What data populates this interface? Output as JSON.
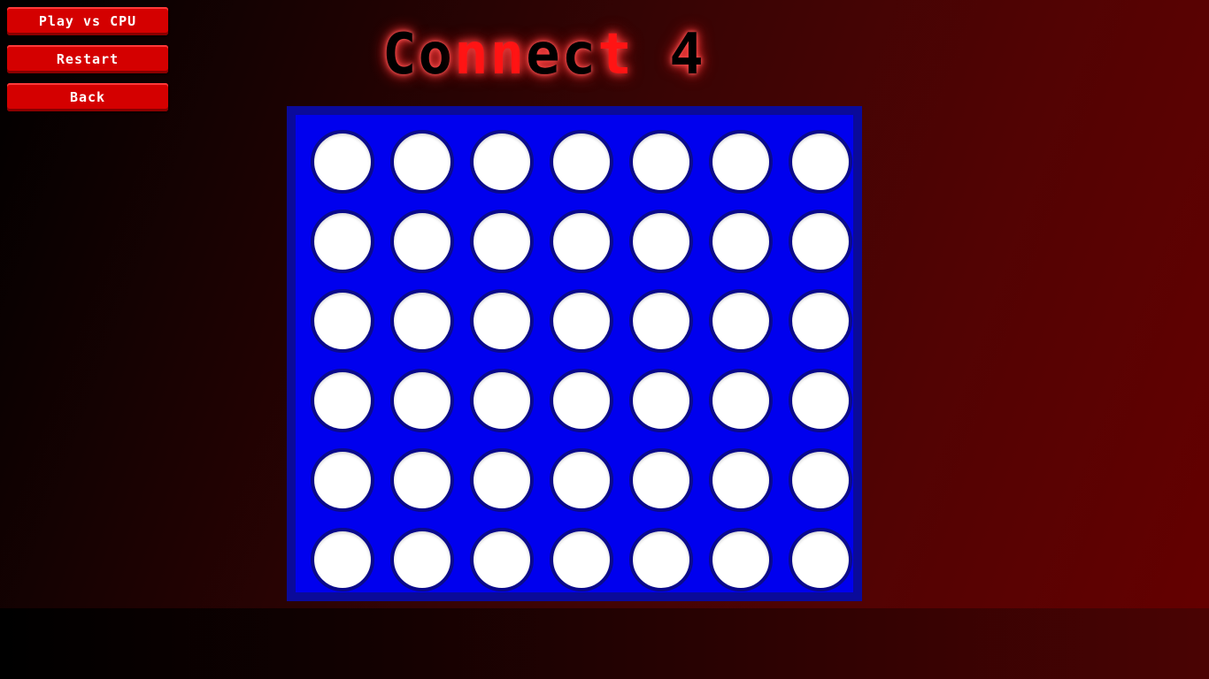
{
  "menu": {
    "play_cpu_label": "Play vs CPU",
    "restart_label": "Restart",
    "back_label": "Back"
  },
  "title": {
    "part1": "Co",
    "part2": "nn",
    "part3": "ec",
    "part4": "t",
    "part5": " 4"
  },
  "board": {
    "rows": 6,
    "columns": 7,
    "cells": [
      [
        "empty",
        "empty",
        "empty",
        "empty",
        "empty",
        "empty",
        "empty"
      ],
      [
        "empty",
        "empty",
        "empty",
        "empty",
        "empty",
        "empty",
        "empty"
      ],
      [
        "empty",
        "empty",
        "empty",
        "empty",
        "empty",
        "empty",
        "empty"
      ],
      [
        "empty",
        "empty",
        "empty",
        "empty",
        "empty",
        "empty",
        "empty"
      ],
      [
        "empty",
        "empty",
        "empty",
        "empty",
        "empty",
        "empty",
        "empty"
      ],
      [
        "empty",
        "empty",
        "empty",
        "empty",
        "empty",
        "empty",
        "empty"
      ]
    ]
  },
  "colors": {
    "button_red": "#d40000",
    "title_accent": "#ff1414",
    "board_blue": "#0000ee",
    "board_border": "#0a0a9a",
    "slot_empty": "#ffffff"
  }
}
